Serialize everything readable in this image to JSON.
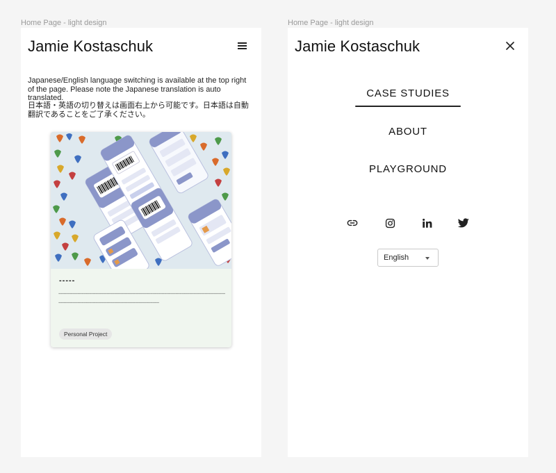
{
  "canvas": {
    "left_frame_label": "Home Page - light design",
    "right_frame_label": "Home Page - light design"
  },
  "home": {
    "site_title": "Jamie Kostaschuk",
    "intro_en": "Japanese/English language switching is available at the top right of the page. Please note the Japanese translation is auto translated.",
    "intro_ja": "日本語・英語の切り替えは画面右上から可能です。日本語は自動翻訳であることをご了承ください。",
    "card": {
      "title": "-----",
      "description": "------------------------------------------------------------------------------------------------------------------------------------------------------------------------------------------------------------------",
      "tag": "Personal Project",
      "image_icon": "app-mockup-illustration"
    }
  },
  "menu": {
    "site_title": "Jamie Kostaschuk",
    "items": [
      {
        "label": "CASE STUDIES",
        "active": true
      },
      {
        "label": "ABOUT",
        "active": false
      },
      {
        "label": "PLAYGROUND",
        "active": false
      }
    ],
    "social_icons": [
      "link-icon",
      "instagram-icon",
      "linkedin-icon",
      "twitter-icon"
    ],
    "language": {
      "selected": "English"
    }
  },
  "colors": {
    "canvas_bg": "#f5f5f5",
    "card_bg": "#f0f6ef",
    "image_bg": "#dfe9ef",
    "phone_accent": "#8b96c9"
  }
}
